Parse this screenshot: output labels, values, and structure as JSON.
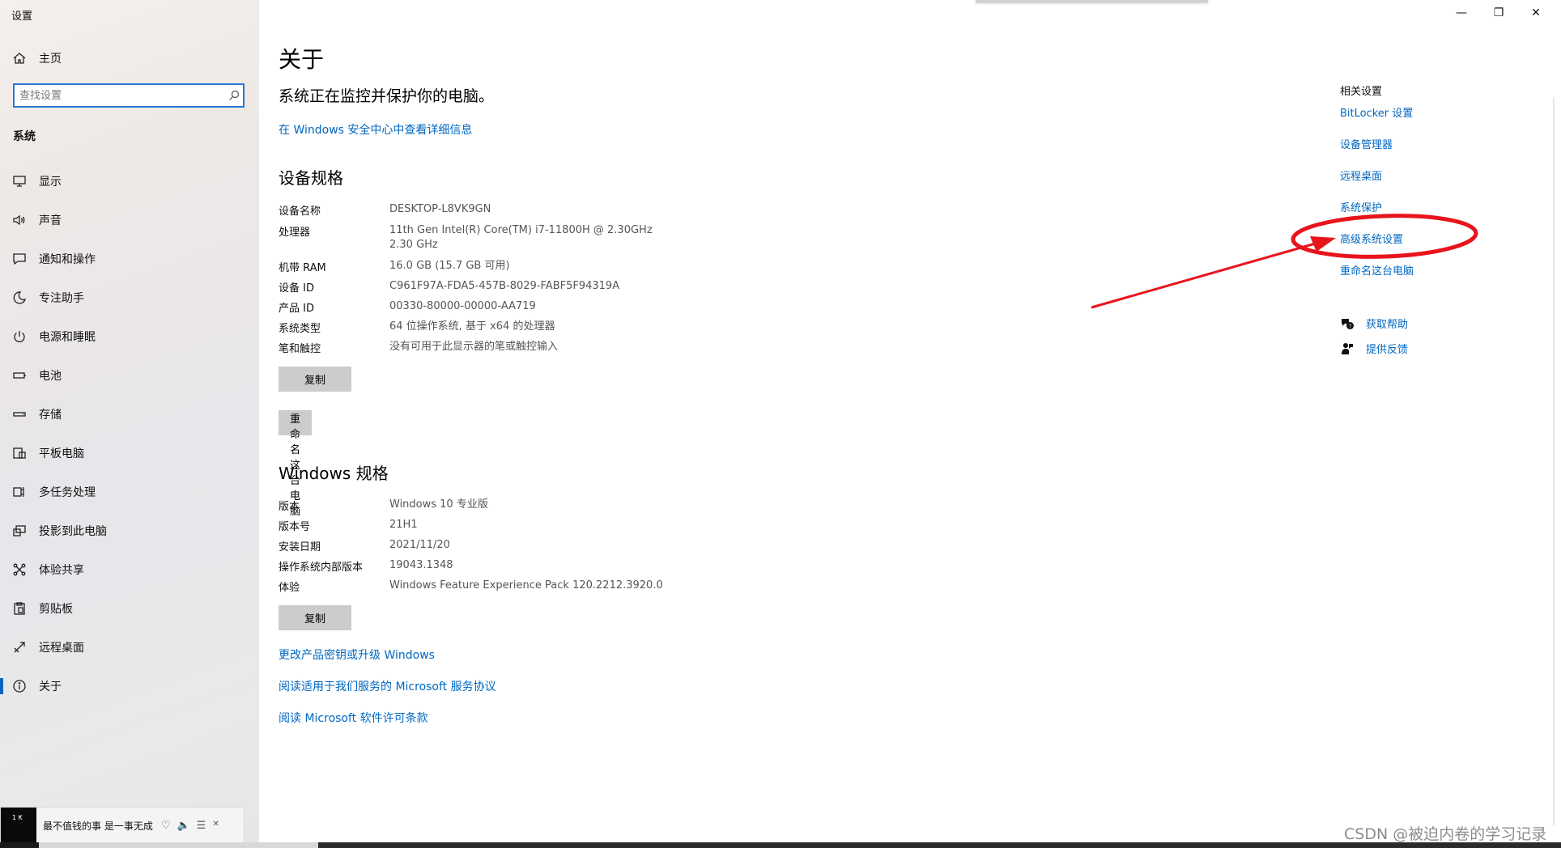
{
  "window": {
    "title": "设置",
    "minimize_glyph": "—",
    "maximize_glyph": "❐",
    "close_glyph": "✕"
  },
  "sidebar": {
    "home": {
      "label": "主页",
      "icon": "home-icon"
    },
    "search": {
      "placeholder": "查找设置",
      "icon": "search-icon"
    },
    "section": "系统",
    "items": [
      {
        "label": "显示",
        "icon": "monitor-icon"
      },
      {
        "label": "声音",
        "icon": "speaker-icon"
      },
      {
        "label": "通知和操作",
        "icon": "notification-icon"
      },
      {
        "label": "专注助手",
        "icon": "moon-icon"
      },
      {
        "label": "电源和睡眠",
        "icon": "power-icon"
      },
      {
        "label": "电池",
        "icon": "battery-icon"
      },
      {
        "label": "存储",
        "icon": "storage-icon"
      },
      {
        "label": "平板电脑",
        "icon": "tablet-icon"
      },
      {
        "label": "多任务处理",
        "icon": "multitask-icon"
      },
      {
        "label": "投影到此电脑",
        "icon": "project-icon"
      },
      {
        "label": "体验共享",
        "icon": "share-icon"
      },
      {
        "label": "剪贴板",
        "icon": "clipboard-icon"
      },
      {
        "label": "远程桌面",
        "icon": "remote-icon"
      },
      {
        "label": "关于",
        "icon": "info-icon",
        "active": true
      }
    ]
  },
  "main": {
    "title": "关于",
    "protect_text": "系统正在监控并保护你的电脑。",
    "security_link": "在 Windows 安全中心中查看详细信息",
    "device_specs": {
      "heading": "设备规格",
      "rows": [
        {
          "key": "设备名称",
          "value": "DESKTOP-L8VK9GN"
        },
        {
          "key": "处理器",
          "value": "11th Gen Intel(R) Core(TM) i7-11800H @ 2.30GHz",
          "value2": "2.30 GHz"
        },
        {
          "key": "机带 RAM",
          "value": "16.0 GB (15.7 GB 可用)"
        },
        {
          "key": "设备 ID",
          "value": "C961F97A-FDA5-457B-8029-FABF5F94319A"
        },
        {
          "key": "产品 ID",
          "value": "00330-80000-00000-AA719"
        },
        {
          "key": "系统类型",
          "value": "64 位操作系统, 基于 x64 的处理器"
        },
        {
          "key": "笔和触控",
          "value": "没有可用于此显示器的笔或触控输入"
        }
      ],
      "copy_button": "复制",
      "rename_button": "重命名这台电脑"
    },
    "windows_specs": {
      "heading": "Windows 规格",
      "rows": [
        {
          "key": "版本",
          "value": "Windows 10 专业版"
        },
        {
          "key": "版本号",
          "value": "21H1"
        },
        {
          "key": "安装日期",
          "value": "2021/11/20"
        },
        {
          "key": "操作系统内部版本",
          "value": "19043.1348"
        },
        {
          "key": "体验",
          "value": "Windows Feature Experience Pack 120.2212.3920.0"
        }
      ],
      "copy_button": "复制"
    },
    "links": {
      "product_key": "更改产品密钥或升级 Windows",
      "service_terms": "阅读适用于我们服务的 Microsoft 服务协议",
      "license_terms": "阅读 Microsoft 软件许可条款"
    }
  },
  "related": {
    "title": "相关设置",
    "links": [
      "BitLocker 设置",
      "设备管理器",
      "远程桌面",
      "系统保护",
      "高级系统设置",
      "重命名这台电脑"
    ],
    "help": [
      {
        "label": "获取帮助",
        "icon": "help-chat-icon"
      },
      {
        "label": "提供反馈",
        "icon": "feedback-icon"
      }
    ]
  },
  "annotation": {
    "color": "#e8141c",
    "target": "高级系统设置"
  },
  "notification": {
    "text": "最不值钱的事 是一事无成",
    "thumb_text": "1 ₭"
  },
  "watermark": "CSDN @被迫内卷的学习记录",
  "colors": {
    "accent": "#0067c0",
    "annotation": "#e8141c",
    "button": "#cccccc"
  }
}
